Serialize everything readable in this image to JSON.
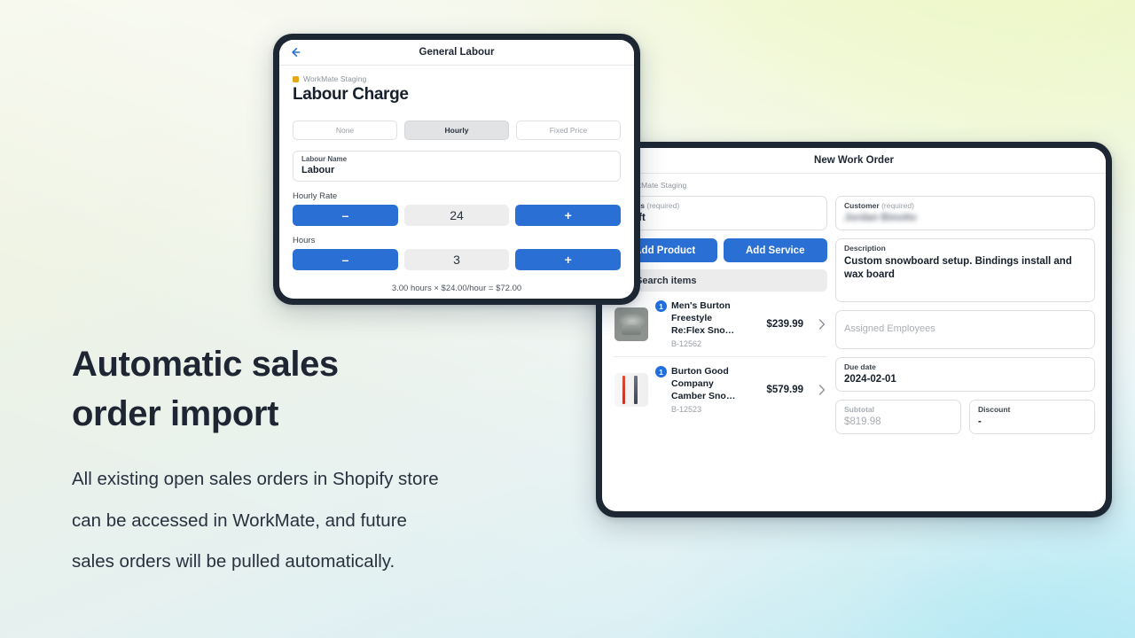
{
  "background": {
    "color_top_left": "#f0f4e0",
    "color_top_right": "#e6f5ab",
    "color_bottom_right": "#b3e8f2",
    "color_bottom_left": "#e9f0f0"
  },
  "theme": {
    "accent_blue": "#2a6fd4",
    "bezel": "#1c2733",
    "text_dark": "#16202c",
    "text_muted": "#9aa0a7"
  },
  "marketing": {
    "headline": "Automatic sales\norder import",
    "body": "All existing open sales orders in Shopify store\ncan be accessed in WorkMate, and future\nsales orders will be pulled automatically."
  },
  "labour_screen": {
    "nav": {
      "title": "General Labour",
      "back_icon": "back-arrow-icon"
    },
    "staging_label": "WorkMate Staging",
    "page_title": "Labour Charge",
    "segments": [
      {
        "label": "None",
        "active": false
      },
      {
        "label": "Hourly",
        "active": true
      },
      {
        "label": "Fixed Price",
        "active": false
      }
    ],
    "labour_name": {
      "label": "Labour Name",
      "value": "Labour"
    },
    "hourly_rate": {
      "label": "Hourly Rate",
      "minus": "–",
      "value": "24",
      "plus": "+"
    },
    "hours": {
      "label": "Hours",
      "minus": "–",
      "value": "3",
      "plus": "+"
    },
    "summary": "3.00 hours × $24.00/hour = $72.00"
  },
  "workorder_screen": {
    "nav": {
      "title": "New Work Order"
    },
    "staging_label": "WorkMate Staging",
    "status": {
      "label": "Status",
      "required": "(required)",
      "value": "Draft"
    },
    "customer": {
      "label": "Customer",
      "required": "(required)",
      "value": "Jordan Binotto"
    },
    "buttons": {
      "add_product": "Add Product",
      "add_service": "Add Service"
    },
    "search": {
      "placeholder": "Search items",
      "icon": "search-icon"
    },
    "items": [
      {
        "qty": "1",
        "name": "Men's Burton Freestyle Re:Flex Sno…",
        "sku": "B-12562",
        "price": "$239.99",
        "thumb": "snowboard-binding-thumbnail"
      },
      {
        "qty": "1",
        "name": "Burton Good Company Camber Sno…",
        "sku": "B-12523",
        "price": "$579.99",
        "thumb": "snowboard-thumbnail"
      }
    ],
    "description": {
      "label": "Description",
      "value": "Custom snowboard setup. Bindings install and wax board"
    },
    "assigned_employees": {
      "placeholder": "Assigned Employees"
    },
    "due_date": {
      "label": "Due date",
      "value": "2024-02-01"
    },
    "subtotal": {
      "label": "Subtotal",
      "value": "$819.98"
    },
    "discount": {
      "label": "Discount",
      "value": "-"
    }
  }
}
